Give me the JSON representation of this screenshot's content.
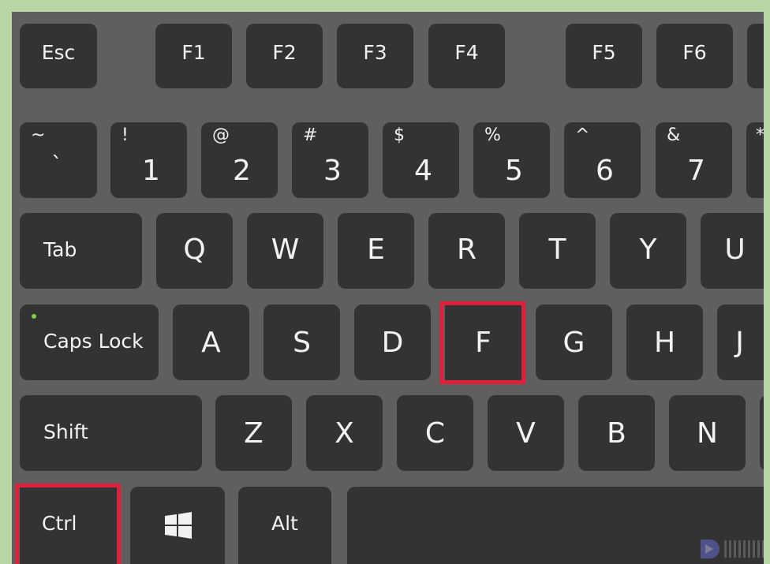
{
  "keyboard": {
    "row1": [
      "Esc",
      "F1",
      "F2",
      "F3",
      "F4",
      "F5",
      "F6"
    ],
    "row2": [
      {
        "shift": "~",
        "main": "`"
      },
      {
        "shift": "!",
        "main": "1"
      },
      {
        "shift": "@",
        "main": "2"
      },
      {
        "shift": "#",
        "main": "3"
      },
      {
        "shift": "$",
        "main": "4"
      },
      {
        "shift": "%",
        "main": "5"
      },
      {
        "shift": "^",
        "main": "6"
      },
      {
        "shift": "&",
        "main": "7"
      },
      {
        "shift": "*",
        "main": ""
      }
    ],
    "row3": [
      "Tab",
      "Q",
      "W",
      "E",
      "R",
      "T",
      "Y",
      "U"
    ],
    "row4": [
      "Caps Lock",
      "A",
      "S",
      "D",
      "F",
      "G",
      "H",
      "J"
    ],
    "row5": [
      "Shift",
      "Z",
      "X",
      "C",
      "V",
      "B",
      "N"
    ],
    "row6": [
      "Ctrl",
      "",
      "Alt",
      ""
    ],
    "highlighted_keys": [
      "Ctrl",
      "F"
    ],
    "highlight_color": "#e0203a",
    "caps_lock_led_color": "#7fd14a",
    "windows_key_icon": "windows-logo-icon"
  }
}
